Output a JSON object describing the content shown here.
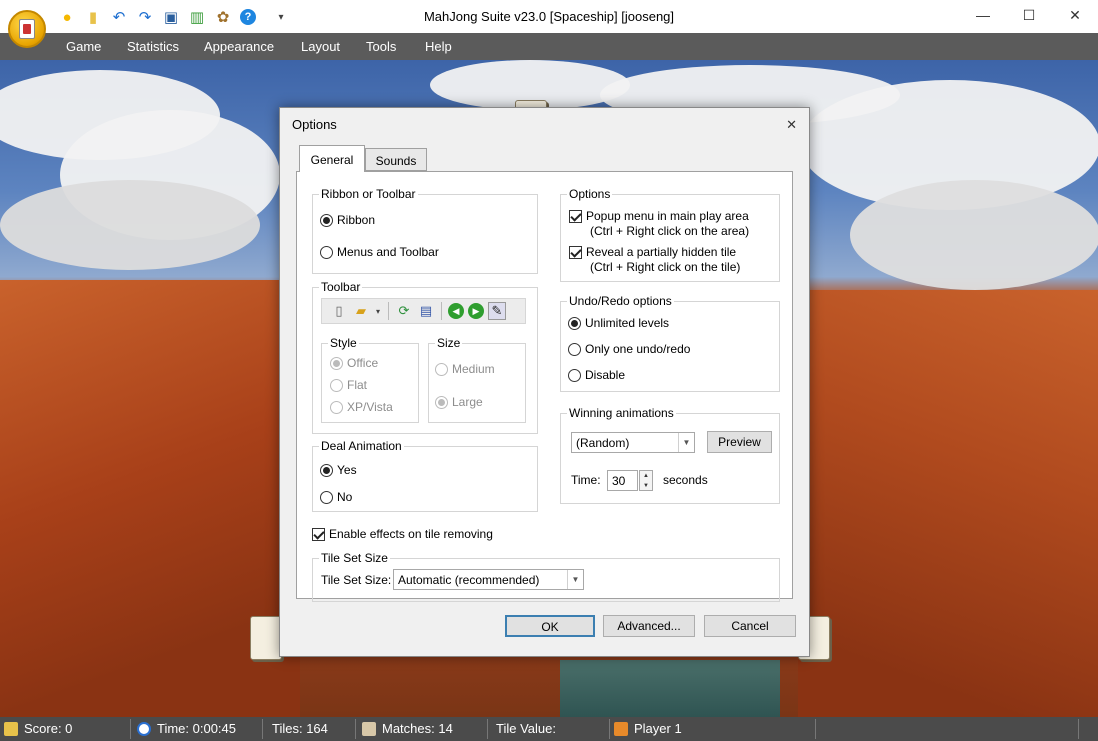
{
  "window": {
    "title": "MahJong Suite v23.0  [Spaceship]  [jooseng]",
    "minimize_glyph": "—",
    "maximize_glyph": "☐",
    "close_glyph": "✕"
  },
  "quick_access": {
    "icons": [
      "sun-icon",
      "new-icon",
      "undo-icon",
      "redo-icon",
      "screen-icon",
      "stats-icon",
      "palette-icon",
      "help-icon",
      "customize-icon"
    ],
    "glyphs": [
      "●",
      "▮",
      "↶",
      "↷",
      "▣",
      "▥",
      "✿",
      "?",
      "▾"
    ]
  },
  "menu": [
    "Game",
    "Statistics",
    "Appearance",
    "Layout",
    "Tools",
    "Help"
  ],
  "dialog": {
    "title": "Options",
    "close_glyph": "✕",
    "tabs": [
      "General",
      "Sounds"
    ],
    "ribbon_group": {
      "legend": "Ribbon or Toolbar",
      "options": [
        "Ribbon",
        "Menus and Toolbar"
      ]
    },
    "toolbar_group": {
      "legend": "Toolbar",
      "icons": [
        "new-file-icon",
        "open-folder-icon",
        "refresh-icon",
        "save-icon",
        "back-icon",
        "forward-icon",
        "edit-icon"
      ],
      "glyphs": [
        "▯",
        "▰",
        "⟳",
        "▤",
        "◀",
        "▶",
        "✎"
      ],
      "dropdown_glyph": "▾",
      "style_legend": "Style",
      "style_options": [
        "Office",
        "Flat",
        "XP/Vista"
      ],
      "size_legend": "Size",
      "size_options": [
        "Medium",
        "Large"
      ]
    },
    "deal_group": {
      "legend": "Deal Animation",
      "options": [
        "Yes",
        "No"
      ]
    },
    "effects_checkbox": "Enable effects on tile removing",
    "tileset_group": {
      "legend": "Tile Set Size",
      "label": "Tile Set Size:",
      "value": "Automatic (recommended)"
    },
    "options_group": {
      "legend": "Options",
      "items": [
        {
          "label": "Popup menu in main play area",
          "sub": "(Ctrl + Right click on the area)"
        },
        {
          "label": "Reveal a partially hidden tile",
          "sub": "(Ctrl + Right click on the tile)"
        }
      ]
    },
    "undo_group": {
      "legend": "Undo/Redo options",
      "options": [
        "Unlimited levels",
        "Only one undo/redo",
        "Disable"
      ]
    },
    "winning_group": {
      "legend": "Winning animations",
      "value": "(Random)",
      "preview_label": "Preview",
      "time_label": "Time:",
      "time_value": "30",
      "seconds_label": "seconds"
    },
    "buttons": {
      "ok": "OK",
      "advanced": "Advanced...",
      "cancel": "Cancel"
    }
  },
  "statusbar": {
    "score": "Score: 0",
    "time": "Time: 0:00:45",
    "tiles": "Tiles: 164",
    "matches": "Matches: 14",
    "tile_value": "Tile Value:",
    "player": "Player 1"
  },
  "colors": {
    "menubar": "#5b5b5b",
    "statusbar": "#4b4b4b",
    "accent": "#e8a400"
  }
}
